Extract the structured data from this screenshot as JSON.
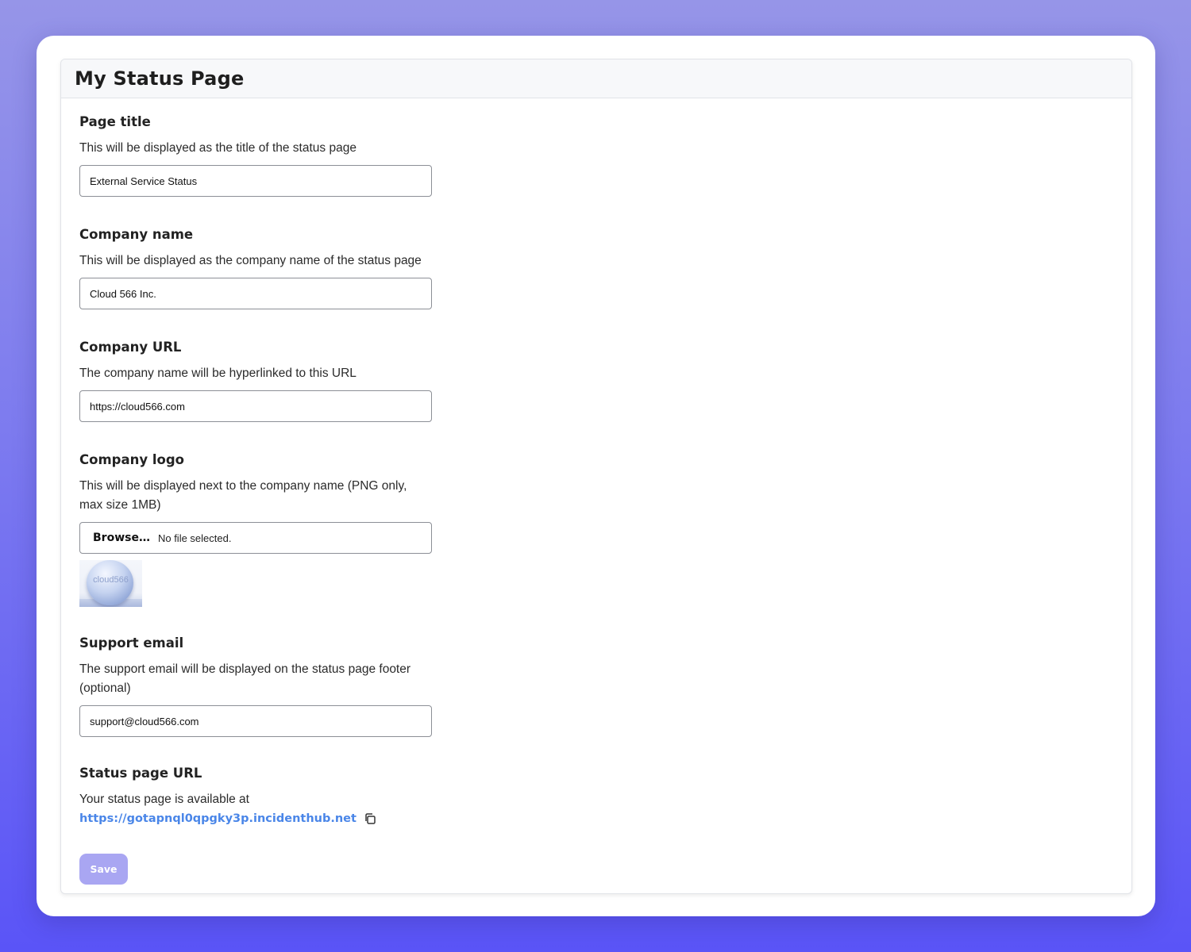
{
  "panel": {
    "title": "My Status Page"
  },
  "form": {
    "page_title": {
      "label": "Page title",
      "help": "This will be displayed as the title of the status page",
      "value": "External Service Status"
    },
    "company_name": {
      "label": "Company name",
      "help": "This will be displayed as the company name of the status page",
      "value": "Cloud 566 Inc."
    },
    "company_url": {
      "label": "Company URL",
      "help": "The company name will be hyperlinked to this URL",
      "value": "https://cloud566.com"
    },
    "company_logo": {
      "label": "Company logo",
      "help": "This will be displayed next to the company name (PNG only, max size 1MB)",
      "browse_label": "Browse…",
      "file_status": "No file selected.",
      "preview_text": "cloud566"
    },
    "support_email": {
      "label": "Support email",
      "help": "The support email will be displayed on the status page footer (optional)",
      "value": "support@cloud566.com"
    },
    "status_page_url": {
      "label": "Status page URL",
      "help": "Your status page is available at",
      "link": "https://gotapnql0qpgky3p.incidenthub.net",
      "copy_icon": "copy-icon"
    },
    "save_label": "Save"
  },
  "colors": {
    "accent_link": "#4a86e8",
    "save_button": "#a9a6f2",
    "background_top": "#9695e8",
    "background_bottom": "#5a54f7"
  }
}
